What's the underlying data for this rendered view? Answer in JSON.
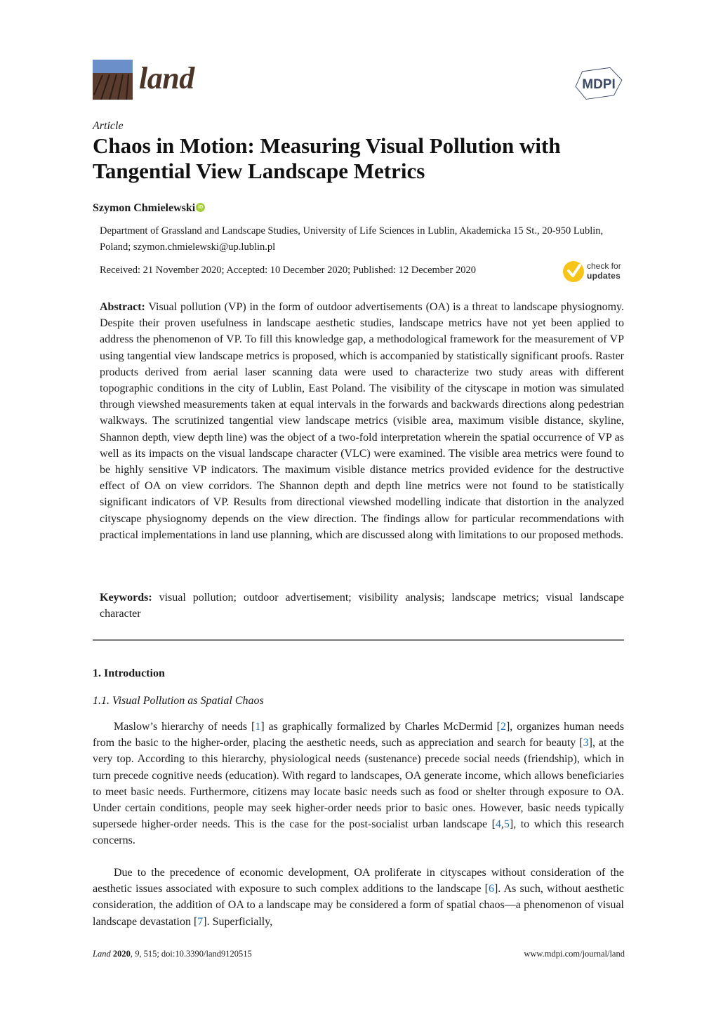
{
  "header": {
    "journal_name": "land",
    "publisher_logo_text": "MDPI",
    "colors": {
      "journal_brown": "#4a3528",
      "sky_blue": "#6b8fc8",
      "soil_brown": "#5a3c2e",
      "orcid_green": "#a6ce39",
      "check_yellow": "#f6c518",
      "mdpi_slate": "#3d4a66",
      "citation_blue": "#1f6fb8"
    }
  },
  "article": {
    "type": "Article",
    "title": "Chaos in Motion: Measuring Visual Pollution with Tangential View Landscape Metrics",
    "author": "Szymon Chmielewski",
    "orcid_icon_text": "iD",
    "affiliation": "Department of Grassland and Landscape Studies, University of Life Sciences in Lublin, Akademicka 15 St., 20-950 Lublin, Poland; szymon.chmielewski@up.lublin.pl",
    "dates": "Received: 21 November 2020; Accepted: 10 December 2020; Published: 12 December 2020",
    "check_updates": {
      "line1": "check for",
      "line2": "updates"
    }
  },
  "abstract": {
    "label": "Abstract:",
    "text": "Visual pollution (VP) in the form of outdoor advertisements (OA) is a threat to landscape physiognomy. Despite their proven usefulness in landscape aesthetic studies, landscape metrics have not yet been applied to address the phenomenon of VP. To fill this knowledge gap, a methodological framework for the measurement of VP using tangential view landscape metrics is proposed, which is accompanied by statistically significant proofs. Raster products derived from aerial laser scanning data were used to characterize two study areas with different topographic conditions in the city of Lublin, East Poland. The visibility of the cityscape in motion was simulated through viewshed measurements taken at equal intervals in the forwards and backwards directions along pedestrian walkways. The scrutinized tangential view landscape metrics (visible area, maximum visible distance, skyline, Shannon depth, view depth line) was the object of a two-fold interpretation wherein the spatial occurrence of VP as well as its impacts on the visual landscape character (VLC) were examined. The visible area metrics were found to be highly sensitive VP indicators. The maximum visible distance metrics provided evidence for the destructive effect of OA on view corridors. The Shannon depth and depth line metrics were not found to be statistically significant indicators of VP. Results from directional viewshed modelling indicate that distortion in the analyzed cityscape physiognomy depends on the view direction. The findings allow for particular recommendations with practical implementations in land use planning, which are discussed along with limitations to our proposed methods."
  },
  "keywords": {
    "label": "Keywords:",
    "text": "visual pollution; outdoor advertisement; visibility analysis; landscape metrics; visual landscape character"
  },
  "introduction": {
    "heading": "1. Introduction",
    "subheading": "1.1. Visual Pollution as Spatial Chaos",
    "para1": [
      {
        "t": "Maslow’s hierarchy of needs "
      },
      {
        "t": "["
      },
      {
        "c": "1"
      },
      {
        "t": "] as graphically formalized by Charles McDermid ["
      },
      {
        "c": "2"
      },
      {
        "t": "], organizes human needs from the basic to the higher-order, placing the aesthetic needs, such as appreciation and search for beauty ["
      },
      {
        "c": "3"
      },
      {
        "t": "], at the very top. According to this hierarchy, physiological needs (sustenance) precede social needs (friendship), which in turn precede cognitive needs (education). With regard to landscapes, OA generate income, which allows beneficiaries to meet basic needs. Furthermore, citizens may locate basic needs such as food or shelter through exposure to OA. Under certain conditions, people may seek higher-order needs prior to basic ones. However, basic needs typically supersede higher-order needs. This is the case for the post-socialist urban landscape ["
      },
      {
        "c": "4"
      },
      {
        "t": ","
      },
      {
        "c": "5"
      },
      {
        "t": "], to which this research concerns."
      }
    ],
    "para2": [
      {
        "t": "Due to the precedence of economic development, OA proliferate in cityscapes without consideration of the aesthetic issues associated with exposure to such complex additions to the landscape ["
      },
      {
        "c": "6"
      },
      {
        "t": "]. As such, without aesthetic consideration, the addition of OA to a landscape may be considered a form of spatial chaos—a phenomenon of visual landscape devastation ["
      },
      {
        "c": "7"
      },
      {
        "t": "]. Superficially,"
      }
    ]
  },
  "footer": {
    "journal": "Land",
    "year": "2020",
    "volume": "9",
    "rest": ", 515; doi:10.3390/land9120515",
    "url": "www.mdpi.com/journal/land"
  }
}
